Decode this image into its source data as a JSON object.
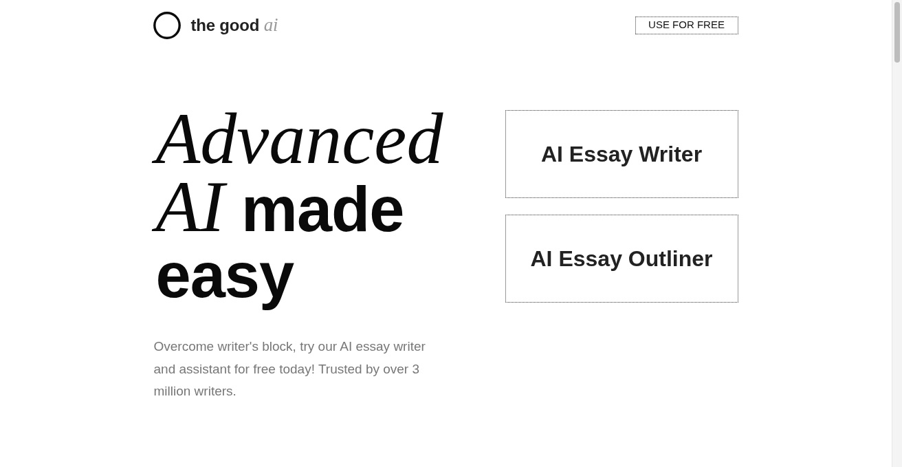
{
  "header": {
    "logo_text": "the good *ai*",
    "cta_button": "USE FOR FREE"
  },
  "hero": {
    "headline": "*Advanced AI* made easy",
    "description": "Overcome writer's block, try our AI essay writer and assistant for free today! Trusted by over 3 million writers."
  },
  "tools": [
    {
      "label": "AI Essay Writer"
    },
    {
      "label": "AI Essay Outliner"
    }
  ]
}
